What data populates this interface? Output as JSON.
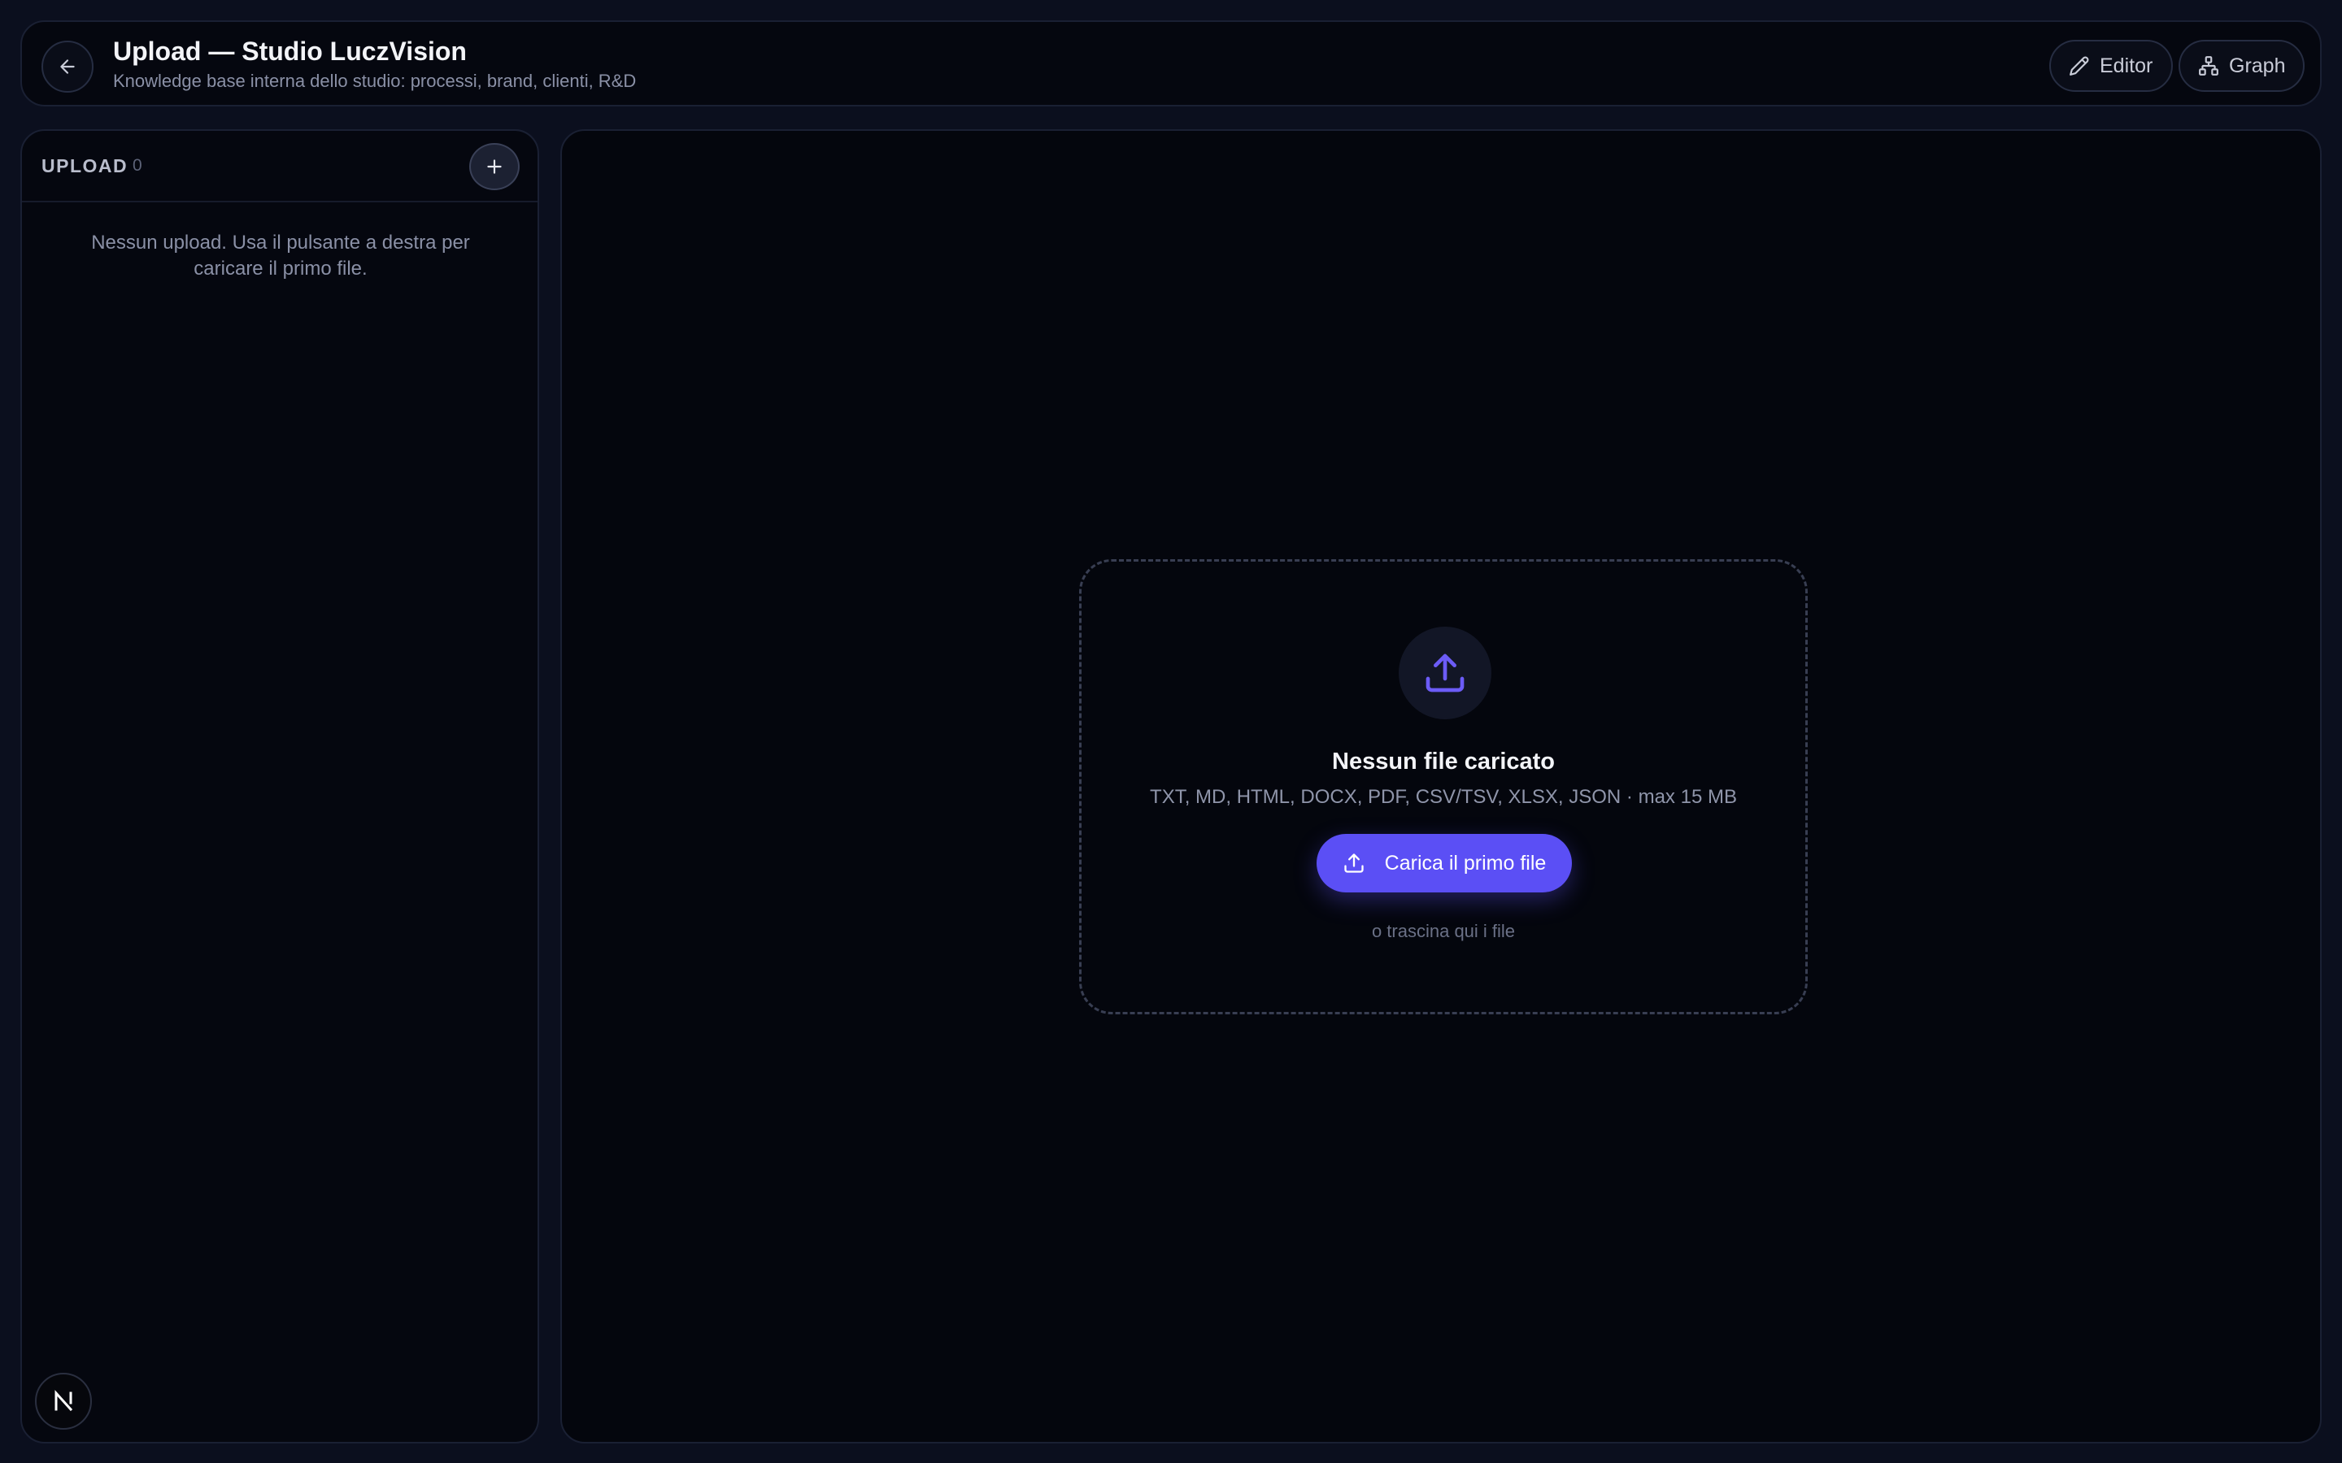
{
  "header": {
    "title": "Upload — Studio LuczVision",
    "subtitle": "Knowledge base interna dello studio: processi, brand, clienti, R&D",
    "back_icon": "arrow-left-icon",
    "editor_label": "Editor",
    "editor_icon": "pencil-icon",
    "graph_label": "Graph",
    "graph_icon": "sitemap-icon"
  },
  "sidebar": {
    "section_label": "UPLOAD",
    "count": "0",
    "add_icon": "plus-icon",
    "empty_message": "Nessun upload. Usa il pulsante a destra per caricare il primo file.",
    "badge_letter": "N"
  },
  "dropzone": {
    "icon": "upload-icon",
    "title": "Nessun file caricato",
    "formats": "TXT, MD, HTML, DOCX, PDF, CSV/TSV, XLSX, JSON · max 15 MB",
    "cta_label": "Carica il primo file",
    "hint": "o trascina qui i file"
  },
  "colors": {
    "accent": "#5b4ff5",
    "background": "#0b0f1e",
    "panel": "#05070f"
  }
}
